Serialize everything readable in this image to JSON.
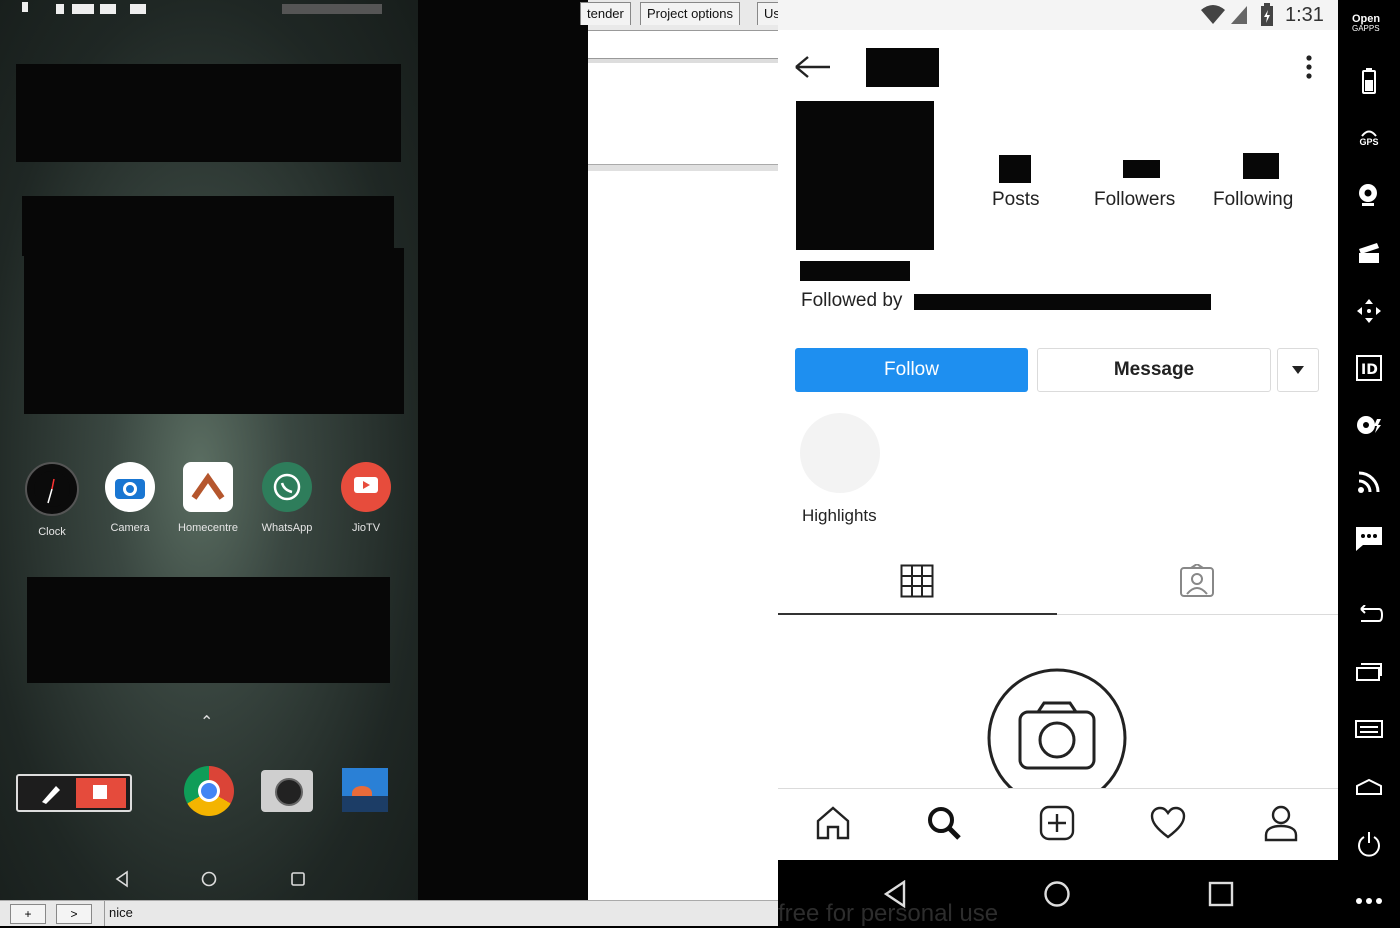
{
  "left_phone": {
    "apps": [
      {
        "label": "Clock",
        "icon": "clock-icon"
      },
      {
        "label": "Camera",
        "icon": "camera-icon"
      },
      {
        "label": "Homecentre",
        "icon": "home-icon"
      },
      {
        "label": "WhatsApp",
        "icon": "whatsapp-icon"
      },
      {
        "label": "JioTV",
        "icon": "play-icon"
      }
    ],
    "dock_icons": [
      "recorder-icon",
      "chrome-icon",
      "camera-icon",
      "photo-icon"
    ],
    "nav": [
      "back-icon",
      "home-icon",
      "recents-icon"
    ]
  },
  "desktop_window": {
    "tabs": [
      {
        "label": "tender"
      },
      {
        "label": "Project options"
      },
      {
        "label": "Us"
      }
    ]
  },
  "instagram": {
    "status_time": "1:31",
    "stats": {
      "posts": "Posts",
      "followers": "Followers",
      "following": "Following"
    },
    "followed_by": "Followed by",
    "follow_button": "Follow",
    "message_button": "Message",
    "highlights": "Highlights",
    "bottom_nav": [
      "home-icon",
      "search-icon",
      "add-post-icon",
      "heart-icon",
      "profile-icon"
    ],
    "system_nav": [
      "back-icon",
      "home-icon",
      "recents-icon"
    ],
    "watermark": "free for personal use",
    "colors": {
      "accent": "#1e8ff0"
    }
  },
  "sidebar": {
    "open_gapps_1": "Open",
    "open_gapps_2": "GAPPS",
    "gps": "GPS",
    "items": [
      "battery-icon",
      "gps-icon",
      "webcam-icon",
      "clapper-icon",
      "move-icon",
      "id-icon",
      "media-icon",
      "rss-icon",
      "message-icon",
      "back-icon",
      "recents-icon",
      "menu-icon",
      "home-icon",
      "power-icon",
      "more-icon"
    ]
  },
  "taskbar": {
    "plus": "+",
    "arrow": ">",
    "field_value": "nice"
  }
}
